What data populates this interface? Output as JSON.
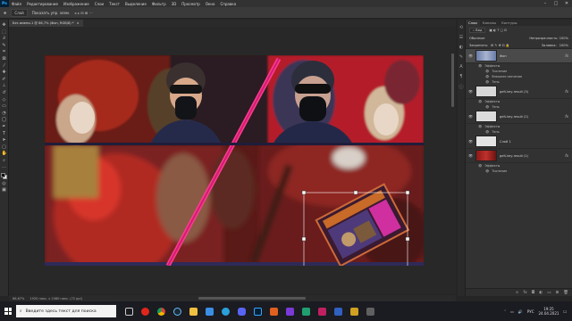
{
  "app": {
    "logo": "Ps"
  },
  "menu": [
    "Файл",
    "Редактирование",
    "Изображение",
    "Слои",
    "Текст",
    "Выделение",
    "Фильтр",
    "3D",
    "Просмотр",
    "Окно",
    "Справка"
  ],
  "window_controls": {
    "minimize": "–",
    "maximize": "□",
    "close": "✕"
  },
  "options_bar": {
    "auto_select": "Слой",
    "show_transform": "Показать упр. элем."
  },
  "document_tab": {
    "title": "Без имени-1 @ 66,7% (Фон, RGB/8) *",
    "close": "×"
  },
  "status_bar": {
    "zoom": "66,67%",
    "doc_info": "1920 пикс. x 1080 пикс. (72 ppi)"
  },
  "panel": {
    "tabs": [
      "Слои",
      "Каналы",
      "Контуры"
    ],
    "active_tab": "Слои",
    "filter_label": "Вид",
    "blend_mode": "Обычные",
    "opacity_label": "Непрозрачность:",
    "opacity_value": "100%",
    "lock_label": "Закрепить:",
    "fill_label": "Заливка:",
    "fill_value": "100%",
    "layers": [
      {
        "name": "Фон",
        "fx": "fx",
        "selected": true,
        "subs": [
          "Эффекты",
          "Тиснение",
          "Внешнее свечение",
          "Тень"
        ]
      },
      {
        "name": "gelt-key-result (3)",
        "fx": "fx",
        "selected": false,
        "subs": [
          "Эффекты",
          "Тень"
        ]
      },
      {
        "name": "gelt-key-result (2)",
        "fx": "fx",
        "selected": false,
        "subs": [
          "Эффекты",
          "Тень"
        ]
      },
      {
        "name": "Слой 1",
        "fx": "",
        "selected": false,
        "subs": []
      },
      {
        "name": "gelt-key-result (1)",
        "fx": "fx",
        "selected": false,
        "subs": [
          "Эффекты",
          "Тиснение"
        ]
      }
    ],
    "bottom_icons": [
      "link-icon",
      "fx-icon",
      "mask-icon",
      "adjust-icon",
      "folder-icon",
      "new-layer-icon",
      "trash-icon"
    ]
  },
  "taskbar": {
    "search_placeholder": "Введите здесь текст для поиска",
    "tray_lang": "РУС",
    "time": "19:25",
    "date": "24.04.2021"
  },
  "colors": {
    "selection": "#31a8ff",
    "accent_pink": "#ff3c8a"
  }
}
